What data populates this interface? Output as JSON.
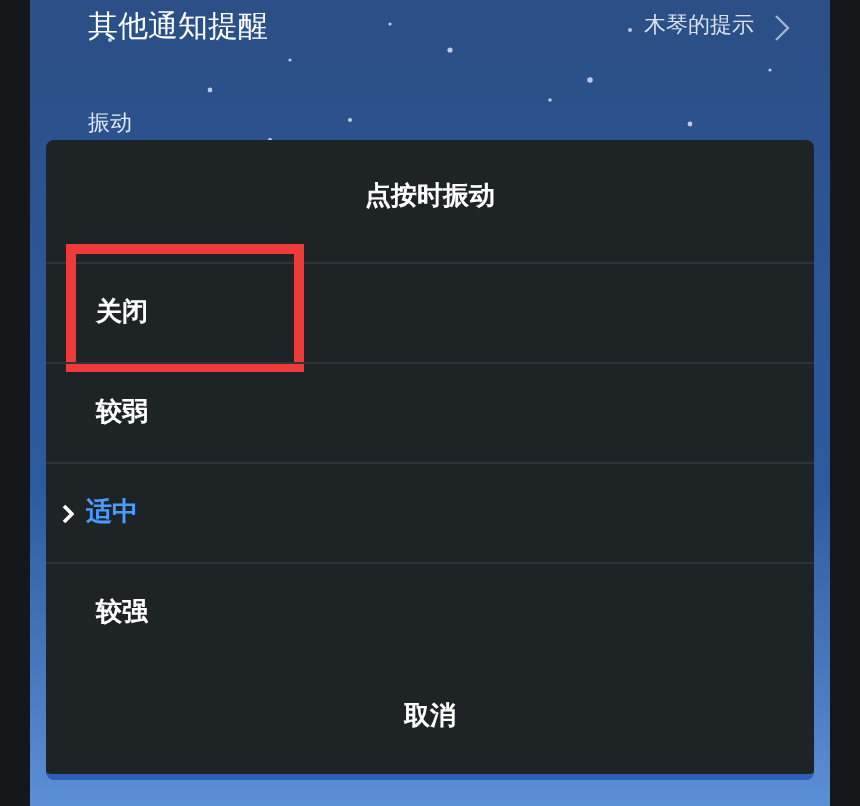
{
  "settings_row": {
    "label": "其他通知提醒",
    "value": "木琴的提示"
  },
  "section_label": "振动",
  "dialog": {
    "title": "点按时振动",
    "options": [
      {
        "label": "关闭",
        "selected": false,
        "highlighted": true
      },
      {
        "label": "较弱",
        "selected": false,
        "highlighted": false
      },
      {
        "label": "适中",
        "selected": true,
        "highlighted": false
      },
      {
        "label": "较强",
        "selected": false,
        "highlighted": false
      }
    ],
    "cancel": "取消"
  }
}
